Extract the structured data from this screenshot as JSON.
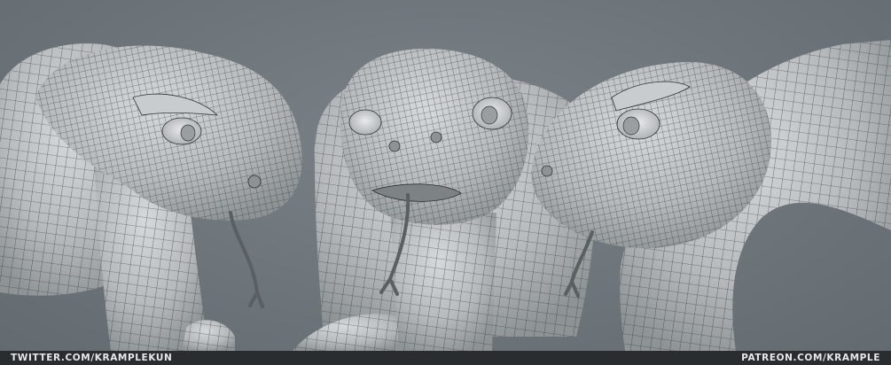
{
  "footer": {
    "left_credit": "TWITTER.COM/KRAMPLEKUN",
    "right_credit": "PATREON.COM/KRAMPLE"
  },
  "colors": {
    "background": "#6f767b",
    "mesh_surface": "#b9bdc0",
    "wire": "#2e3236",
    "footer_bar": "#2a2d30",
    "footer_text": "#e6e8ea"
  }
}
